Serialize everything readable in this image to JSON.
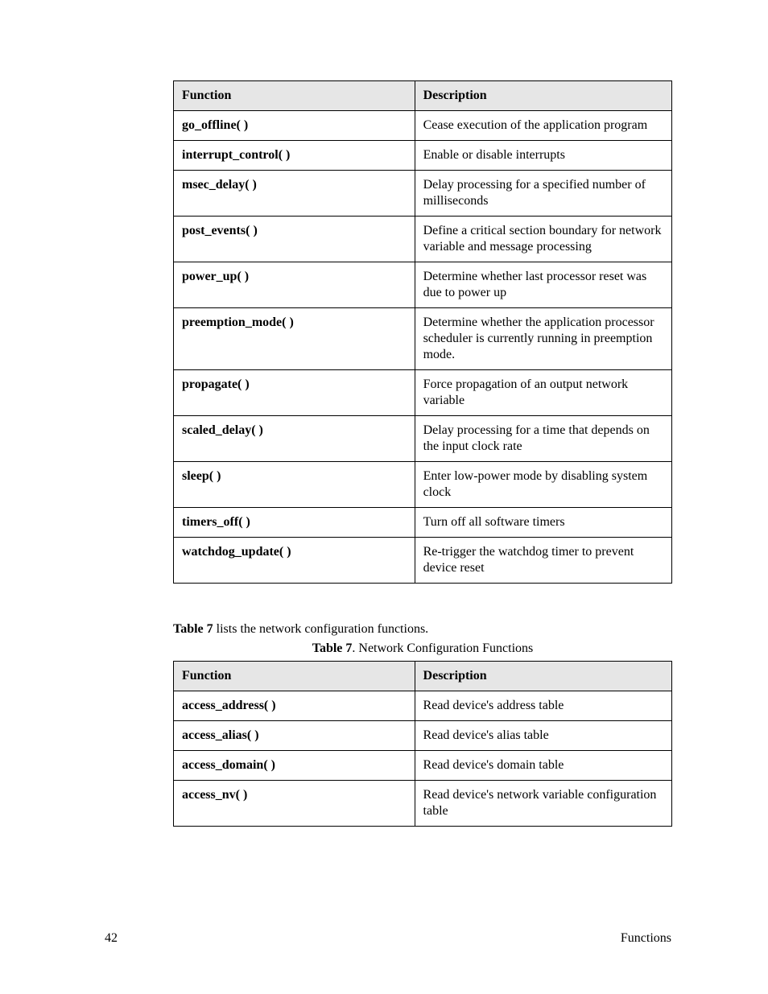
{
  "table1": {
    "headers": [
      "Function",
      "Description"
    ],
    "rows": [
      {
        "fn": "go_offline( )",
        "desc": "Cease execution of the application program"
      },
      {
        "fn": "interrupt_control( )",
        "desc": "Enable or disable interrupts"
      },
      {
        "fn": "msec_delay( )",
        "desc": "Delay processing for a specified number of milliseconds"
      },
      {
        "fn": "post_events( )",
        "desc": "Define a critical section boundary for network variable and message processing"
      },
      {
        "fn": "power_up( )",
        "desc": "Determine whether last processor reset was due to power up"
      },
      {
        "fn": "preemption_mode( )",
        "desc": "Determine whether the application processor scheduler is currently running in preemption mode."
      },
      {
        "fn": "propagate( )",
        "desc": "Force propagation of an output network variable"
      },
      {
        "fn": "scaled_delay( )",
        "desc": "Delay processing for a time that depends on the input clock rate"
      },
      {
        "fn": "sleep( )",
        "desc": "Enter low-power mode by disabling system clock"
      },
      {
        "fn": "timers_off( )",
        "desc": "Turn off all software timers"
      },
      {
        "fn": "watchdog_update( )",
        "desc": "Re-trigger the watchdog timer to prevent device reset"
      }
    ]
  },
  "intro": {
    "label_bold": "Table 7",
    "rest": " lists the network configuration functions."
  },
  "caption": {
    "label_bold": "Table 7",
    "rest": ". Network Configuration Functions"
  },
  "table2": {
    "headers": [
      "Function",
      "Description"
    ],
    "rows": [
      {
        "fn": "access_address( )",
        "desc": "Read device's address table"
      },
      {
        "fn": "access_alias( )",
        "desc": "Read device's alias table"
      },
      {
        "fn": "access_domain( )",
        "desc": "Read device's domain table"
      },
      {
        "fn": "access_nv( )",
        "desc": "Read device's network variable configuration table"
      }
    ]
  },
  "footer": {
    "page": "42",
    "section": "Functions"
  }
}
